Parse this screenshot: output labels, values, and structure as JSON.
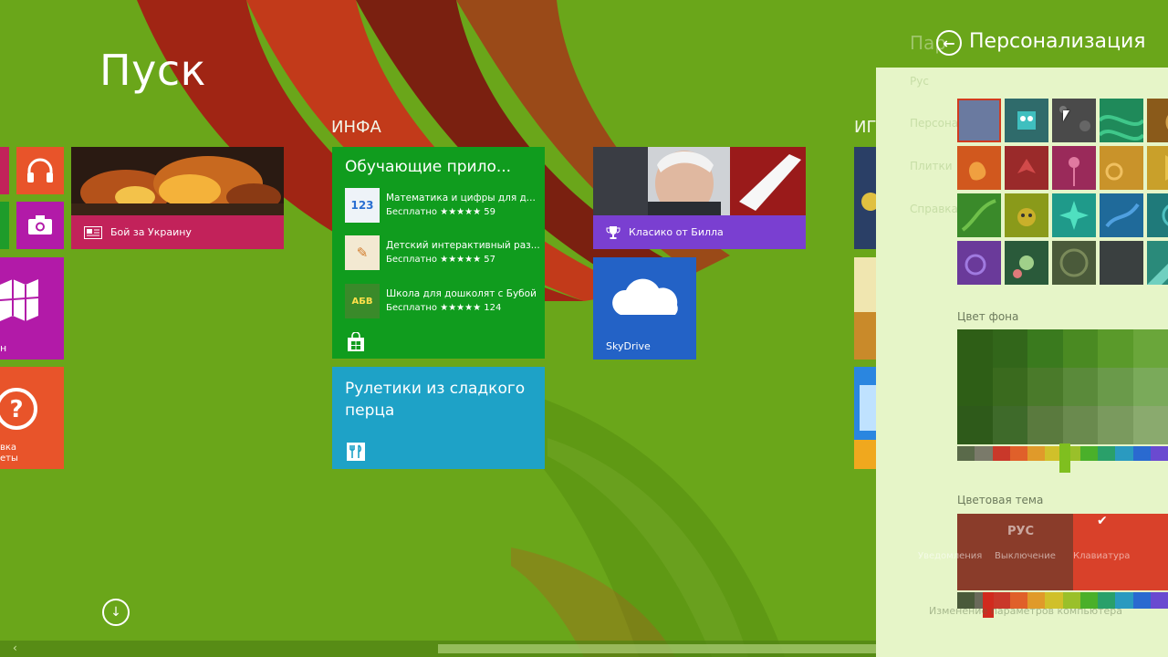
{
  "start": {
    "title": "Пуск",
    "scroll_down_label": "↓"
  },
  "groups": {
    "info_label": "ИНФА",
    "games_label": "ИГ"
  },
  "tiles": {
    "ukraine_label": "Бой за Украину",
    "help_line1": "вка",
    "help_line2": "еты",
    "partial_label": "н",
    "store": {
      "heading": "Обучающие прило...",
      "apps": [
        {
          "name": "Математика и цифры для д...",
          "rating": "Бесплатно ★★★★★ 59",
          "thumb": "123"
        },
        {
          "name": "Детский интерактивный раз...",
          "rating": "Бесплатно ★★★★★ 57",
          "thumb": "✎"
        },
        {
          "name": "Школа для дошколят с Бубой",
          "rating": "Бесплатно ★★★★★ 124",
          "thumb": "АБВ"
        }
      ]
    },
    "recipes_title": "Рулетики из сладкого перца",
    "sport_label": "Класико от Билла",
    "skydrive_label": "SkyDrive"
  },
  "panel": {
    "back_label": "←",
    "title": "Персонализация",
    "ghost_title": "Пар",
    "ghost_items": [
      "Рус",
      "Персонализа",
      "Плитки",
      "Справка"
    ],
    "bg_color_label": "Цвет фона",
    "theme_label": "Цветовая тема",
    "ghost_bar_labels": [
      "Уведомления",
      "Выключение",
      "Клавиатура"
    ],
    "ghost_footer": "Изменение параметров компьютера",
    "rus_label": "РУС",
    "check_label": "✔"
  },
  "colors": {
    "background": "#6aa61a",
    "panel": "#e6f5c8",
    "store_tile": "#109c1e",
    "recipe_tile": "#1ea2c7",
    "skydrive_tile": "#2362c6",
    "purple_strip": "#7a3fd1",
    "pink_strip": "#c2225a",
    "magenta_tile": "#b21aa8",
    "orange_tile": "#e8542a"
  }
}
